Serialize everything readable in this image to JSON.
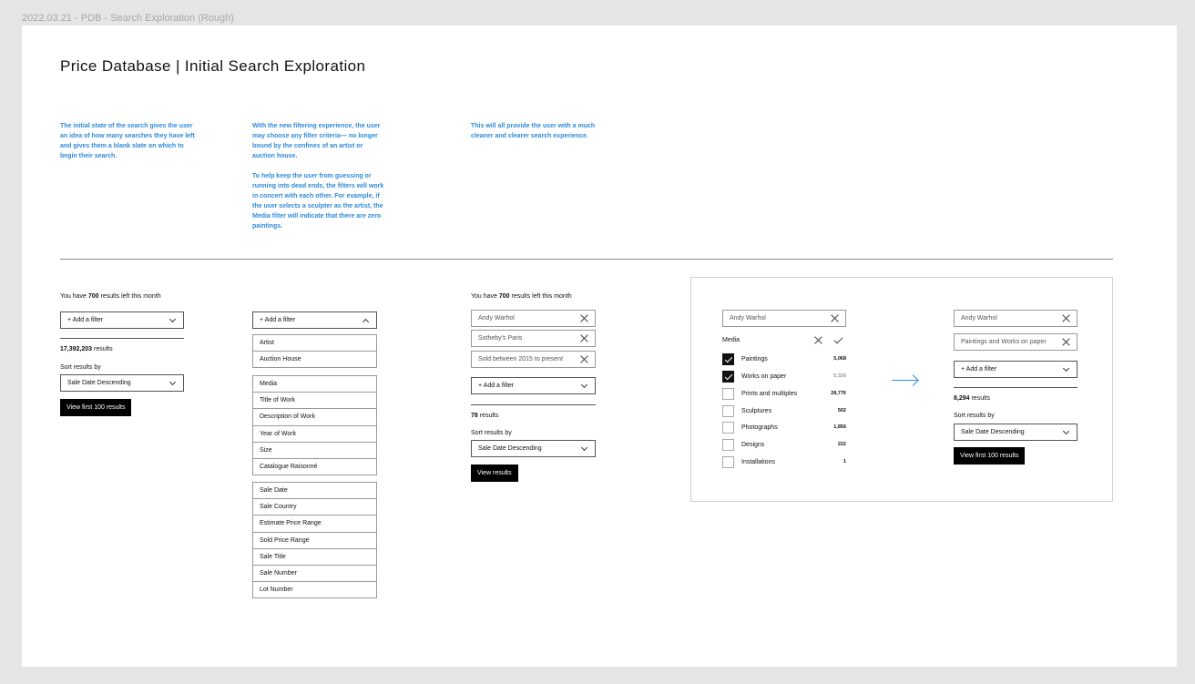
{
  "canvas_label": "2022.03.21 - PDB - Search Exploration (Rough)",
  "title": "Price Database  |  Initial Search Exploration",
  "notes": {
    "col1": [
      "The initial state of the search gives the user an idea of how many searches they have left and gives them a blank slate on which to begin their search."
    ],
    "col2": [
      "With the new filtering experience, the user may choose any filter criteria— no longer bound by the confines of an artist or auction house.",
      "To help keep the user from guessing or running into dead ends, the filters will work in concert with each other. For example, if the user selects a sculpter as the artist, the Media filter will indicate that there are zero paintings."
    ],
    "col3": [
      "This will all provide the user with a much cleaner and clearer search experience."
    ]
  },
  "state1": {
    "remaining_prefix": "You have ",
    "remaining_count": "700",
    "remaining_suffix": " results left this month",
    "add_filter": "+ Add a filter",
    "results_count": "17,392,203",
    "results_suffix": " results",
    "sort_label": "Sort results by",
    "sort_value": "Sale Date Descending",
    "view_button": "View first 100 results"
  },
  "state2": {
    "add_filter": "+ Add a filter",
    "groups": [
      [
        "Artist",
        "Auction House"
      ],
      [
        "Media",
        "Title of Work",
        "Description of Work",
        "Year of Work",
        "Size",
        "Catalogue Raisonné"
      ],
      [
        "Sale Date",
        "Sale Country",
        "Estimate Price Range",
        "Sold Price Range",
        "Sale Title",
        "Sale Number",
        "Lot Number"
      ]
    ]
  },
  "state3": {
    "remaining_prefix": "You have ",
    "remaining_count": "700",
    "remaining_suffix": " results left this month",
    "chips": [
      "Andy Warhol",
      "Sotheby's  Paris",
      "Sold between 2015 to present"
    ],
    "add_filter": "+ Add a filter",
    "results_count": "78",
    "results_suffix": " results",
    "sort_label": "Sort results by",
    "sort_value": "Sale Date Descending",
    "view_button": "View results"
  },
  "state4": {
    "chip": "Andy Warhol",
    "media_label": "Media",
    "media_options": [
      {
        "label": "Paintings",
        "count": "5,068",
        "checked": true,
        "bold": true
      },
      {
        "label": "Works on paper",
        "count": "5,326",
        "checked": true,
        "bold": false
      },
      {
        "label": "Prints and multiples",
        "count": "28,776",
        "checked": false,
        "bold": true
      },
      {
        "label": "Sculptures",
        "count": "502",
        "checked": false,
        "bold": true
      },
      {
        "label": "Photographs",
        "count": "1,856",
        "checked": false,
        "bold": true
      },
      {
        "label": "Designs",
        "count": "222",
        "checked": false,
        "bold": true
      },
      {
        "label": "Installations",
        "count": "1",
        "checked": false,
        "bold": true
      }
    ]
  },
  "state5": {
    "chips": [
      "Andy Warhol",
      "Paintings and Works on paper"
    ],
    "add_filter": "+ Add a filter",
    "results_count": "8,294",
    "results_suffix": " results",
    "sort_label": "Sort results by",
    "sort_value": "Sale Date Descending",
    "view_button": "View first 100 results"
  },
  "colors": {
    "note_blue": "#2f8ad8",
    "arrow_blue": "#2f8ad8",
    "button_black": "#000000"
  }
}
